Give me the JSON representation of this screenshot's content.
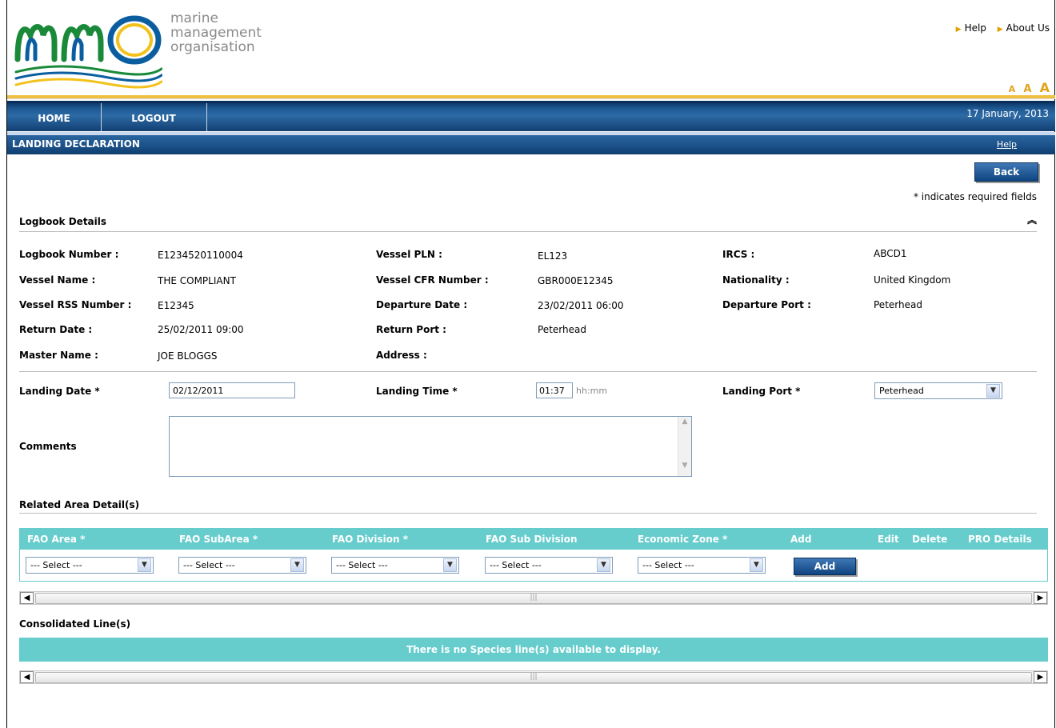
{
  "header": {
    "org_name_line1": "marine",
    "org_name_line2": "management",
    "org_name_line3": "organisation",
    "links": [
      "Help",
      "About Us"
    ],
    "text_size": [
      "A",
      "A",
      "A"
    ]
  },
  "nav": {
    "home": "HOME",
    "logout": "LOGOUT",
    "date": "17 January, 2013"
  },
  "subbar": {
    "title": "LANDING DECLARATION",
    "help": "Help"
  },
  "back_button": "Back",
  "required_note": "* indicates required fields",
  "logbook": {
    "section_title": "Logbook Details",
    "logbook_number_label": "Logbook Number :",
    "logbook_number": "E1234520110004",
    "vessel_pln_label": "Vessel PLN :",
    "vessel_pln": "EL123",
    "ircs_label": "IRCS :",
    "ircs": "ABCD1",
    "vessel_name_label": "Vessel Name :",
    "vessel_name": "THE COMPLIANT",
    "vessel_cfr_label": "Vessel CFR Number :",
    "vessel_cfr": "GBR000E12345",
    "nationality_label": "Nationality :",
    "nationality": "United Kingdom",
    "vessel_rss_label": "Vessel RSS Number :",
    "vessel_rss": "E12345",
    "departure_date_label": "Departure Date :",
    "departure_date": "23/02/2011 06:00",
    "departure_port_label": "Departure Port :",
    "departure_port": "Peterhead",
    "return_date_label": "Return Date :",
    "return_date": "25/02/2011 09:00",
    "return_port_label": "Return Port :",
    "return_port": "Peterhead",
    "master_name_label": "Master Name :",
    "master_name": "JOE BLOGGS",
    "address_label": "Address :"
  },
  "landing": {
    "date_label": "Landing Date *",
    "date_value": "02/12/2011",
    "time_label": "Landing Time *",
    "time_value": "01:37",
    "time_hint": "hh:mm",
    "port_label": "Landing Port *",
    "port_value": "Peterhead",
    "comments_label": "Comments"
  },
  "area": {
    "section_title": "Related Area Detail(s)",
    "columns": [
      "FAO Area *",
      "FAO SubArea *",
      "FAO Division *",
      "FAO Sub Division",
      "Economic Zone *",
      "Add",
      "Edit",
      "Delete",
      "PRO Details"
    ],
    "select_placeholder": "--- Select ---",
    "add_button": "Add"
  },
  "consolidated": {
    "section_title": "Consolidated Line(s)",
    "empty_message": "There is no Species line(s) available to display."
  },
  "colors": {
    "navy": "#123f72",
    "teal": "#66cccc",
    "gold": "#f0c040"
  }
}
